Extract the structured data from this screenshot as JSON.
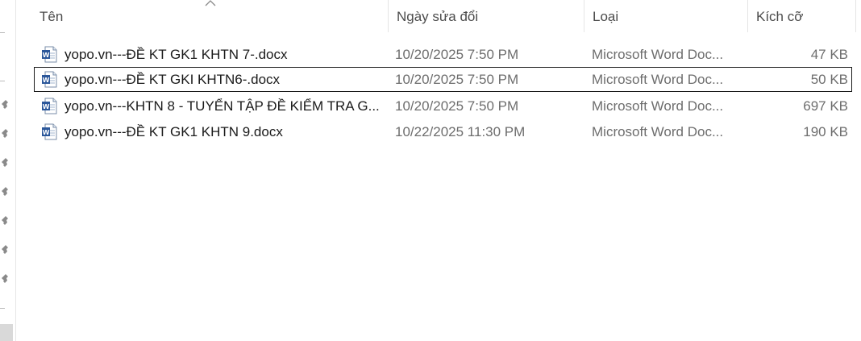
{
  "columns": {
    "name": "Tên",
    "date": "Ngày sửa đổi",
    "type": "Loại",
    "size": "Kích cỡ"
  },
  "files": [
    {
      "name": "yopo.vn---ĐỀ KT GK1 KHTN 7-.docx",
      "date": "10/20/2025 7:50 PM",
      "type": "Microsoft Word Doc...",
      "size": "47 KB",
      "icon": "word-document-icon"
    },
    {
      "name": "yopo.vn---ĐỀ KT GKI KHTN6-.docx",
      "date": "10/20/2025 7:50 PM",
      "type": "Microsoft Word Doc...",
      "size": "50 KB",
      "icon": "word-document-icon",
      "focused": true
    },
    {
      "name": "yopo.vn---KHTN 8 - TUYỂN TẬP ĐỀ KIỂM TRA G...",
      "date": "10/20/2025 7:50 PM",
      "type": "Microsoft Word Doc...",
      "size": "697 KB",
      "icon": "word-document-icon"
    },
    {
      "name": "yopo.vn---ĐỀ KT GK1 KHTN 9.docx",
      "date": "10/22/2025 11:30 PM",
      "type": "Microsoft Word Doc...",
      "size": "190 KB",
      "icon": "word-document-icon"
    }
  ],
  "sort": {
    "column": "name",
    "direction": "ascending",
    "icon": "sort-up-icon"
  },
  "nav_pins": {
    "count": 7,
    "icon": "pin-icon"
  }
}
